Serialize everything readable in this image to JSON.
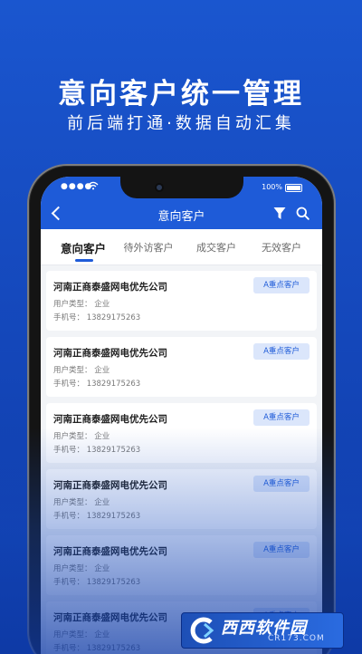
{
  "promo": {
    "title": "意向客户统一管理",
    "subtitle": "前后端打通·数据自动汇集"
  },
  "status_bar": {
    "battery": "100%"
  },
  "nav": {
    "title": "意向客户"
  },
  "tabs": [
    {
      "label": "意向客户",
      "active": true
    },
    {
      "label": "待外访客户",
      "active": false
    },
    {
      "label": "成交客户",
      "active": false
    },
    {
      "label": "无效客户",
      "active": false
    }
  ],
  "customers": [
    {
      "company": "河南正商泰盛网电优先公司",
      "type": "用户类型： 企业",
      "phone": "手机号： 13829175263",
      "tag": "A重点客户"
    },
    {
      "company": "河南正商泰盛网电优先公司",
      "type": "用户类型： 企业",
      "phone": "手机号： 13829175263",
      "tag": "A重点客户"
    },
    {
      "company": "河南正商泰盛网电优先公司",
      "type": "用户类型： 企业",
      "phone": "手机号： 13829175263",
      "tag": "A重点客户"
    },
    {
      "company": "河南正商泰盛网电优先公司",
      "type": "用户类型： 企业",
      "phone": "手机号： 13829175263",
      "tag": "A重点客户"
    },
    {
      "company": "河南正商泰盛网电优先公司",
      "type": "用户类型： 企业",
      "phone": "手机号： 13829175263",
      "tag": "A重点客户"
    },
    {
      "company": "河南正商泰盛网电优先公司",
      "type": "用户类型： 企业",
      "phone": "手机号： 13829175263",
      "tag": "A重点客户"
    }
  ],
  "watermark": {
    "brand": "西西软件园",
    "domain": "CR173.COM"
  },
  "colors": {
    "background": "#1549bd",
    "header": "#1e5bd8",
    "tag_bg": "#dbe6fb",
    "tag_text": "#1e5bd8"
  }
}
